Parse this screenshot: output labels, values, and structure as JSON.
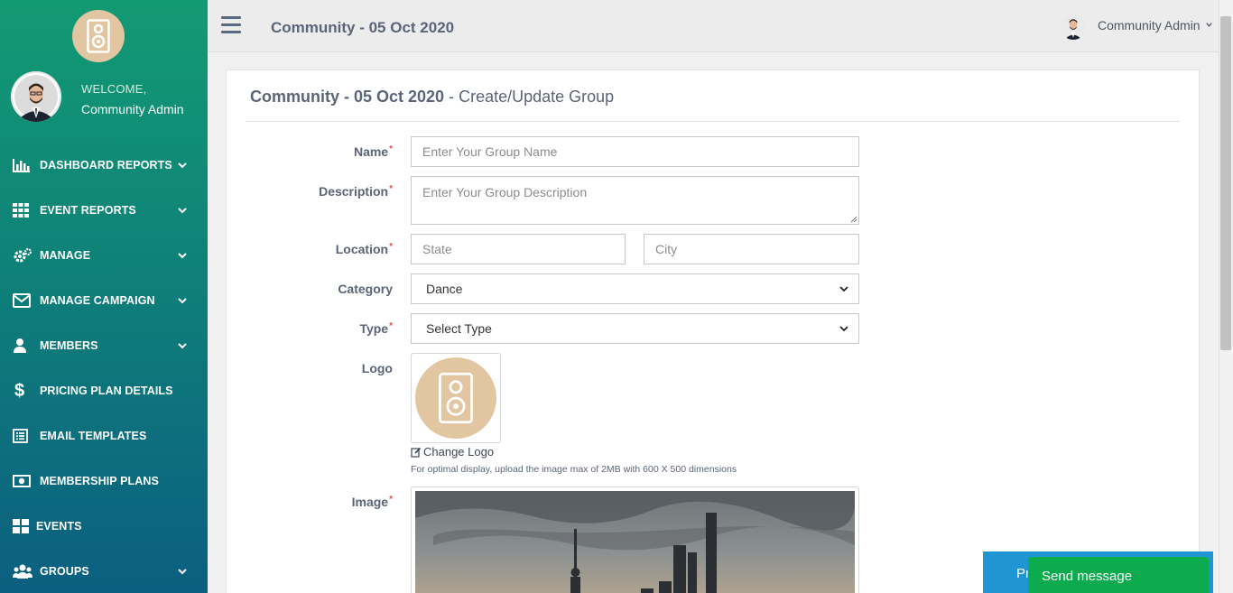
{
  "sidebar": {
    "welcome": "WELCOME,",
    "user_name": "Community Admin",
    "items": [
      {
        "label": "DASHBOARD REPORTS",
        "icon": "bar-chart-icon",
        "has_chevron": true
      },
      {
        "label": "EVENT REPORTS",
        "icon": "grid-icon",
        "has_chevron": true
      },
      {
        "label": "MANAGE",
        "icon": "cogs-icon",
        "has_chevron": true
      },
      {
        "label": "MANAGE CAMPAIGN",
        "icon": "envelope-icon",
        "has_chevron": true
      },
      {
        "label": "MEMBERS",
        "icon": "user-icon",
        "has_chevron": true
      },
      {
        "label": "PRICING PLAN DETAILS",
        "icon": "dollar-icon",
        "has_chevron": false
      },
      {
        "label": "EMAIL TEMPLATES",
        "icon": "list-alt-icon",
        "has_chevron": false
      },
      {
        "label": "MEMBERSHIP PLANS",
        "icon": "money-icon",
        "has_chevron": false
      },
      {
        "label": "EVENTS",
        "icon": "th-large-icon",
        "has_chevron": false
      },
      {
        "label": "GROUPS",
        "icon": "users-icon",
        "has_chevron": true
      }
    ]
  },
  "header": {
    "title": "Community - 05 Oct 2020",
    "user_menu": "Community Admin"
  },
  "form": {
    "title_bold": "Community - 05 Oct 2020",
    "title_rest": " - Create/Update Group",
    "name_label": "Name",
    "name_placeholder": "Enter Your Group Name",
    "description_label": "Description",
    "description_placeholder": "Enter Your Group Description",
    "location_label": "Location",
    "state_placeholder": "State",
    "city_placeholder": "City",
    "category_label": "Category",
    "category_value": "Dance",
    "type_label": "Type",
    "type_value": "Select Type",
    "logo_label": "Logo",
    "change_logo": "Change Logo",
    "logo_hint": "For optimal display, upload the image max of 2MB with 600 X 500 dimensions",
    "image_label": "Image",
    "required_mark": "*"
  },
  "footer": {
    "blue_button": "Pr",
    "send_message": "Send message"
  },
  "colors": {
    "sidebar_top": "#129a73",
    "sidebar_bottom": "#0b5f80",
    "logo_bg": "#e2c6a1",
    "required": "#d9534f",
    "send_message_bg": "#0cab4d",
    "blue_button_bg": "#1f95d3"
  }
}
